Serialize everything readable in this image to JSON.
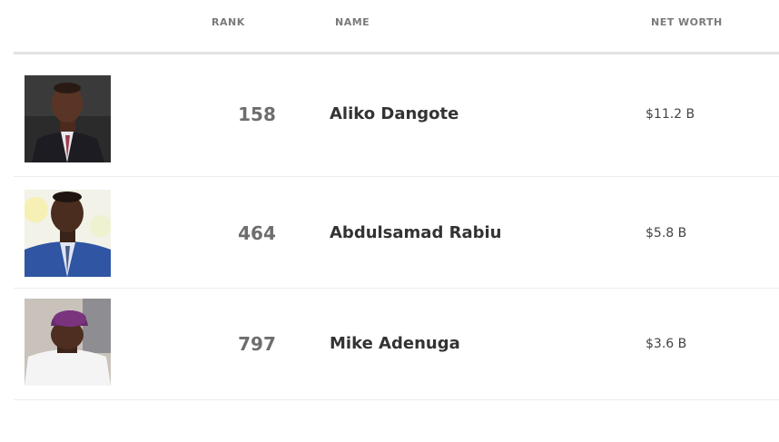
{
  "table": {
    "headers": {
      "rank": "RANK",
      "name": "NAME",
      "net_worth": "NET WORTH"
    },
    "rows": [
      {
        "rank": "158",
        "name": "Aliko Dangote",
        "net_worth": "$11.2 B"
      },
      {
        "rank": "464",
        "name": "Abdulsamad Rabiu",
        "net_worth": "$5.8 B"
      },
      {
        "rank": "797",
        "name": "Mike Adenuga",
        "net_worth": "$3.6 B"
      }
    ]
  },
  "colors": {
    "header_text": "#7a7a7a",
    "rank_text": "#6e6e6e",
    "name_text": "#333333",
    "divider": "#e3e3e3"
  }
}
